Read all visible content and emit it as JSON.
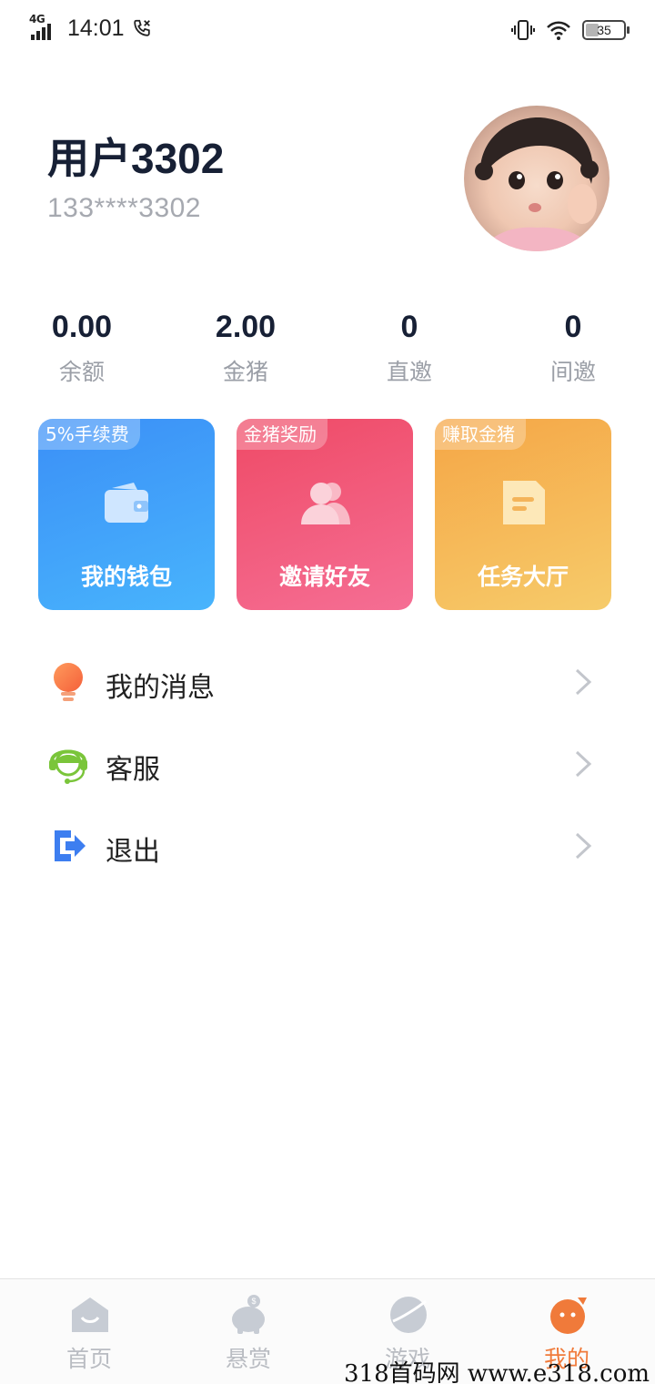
{
  "status_bar": {
    "network": "4G",
    "time": "14:01",
    "battery": "35",
    "battery_level": 0.35,
    "icons": [
      "signal-icon",
      "call-icon",
      "vibrate-icon",
      "wifi-icon",
      "battery-icon"
    ]
  },
  "profile": {
    "name": "用户3302",
    "phone": "133****3302"
  },
  "stats": [
    {
      "value": "0.00",
      "label": "余额"
    },
    {
      "value": "2.00",
      "label": "金猪"
    },
    {
      "value": "0",
      "label": "直邀"
    },
    {
      "value": "0",
      "label": "间邀"
    }
  ],
  "cards": {
    "wallet": {
      "tag": "5%手续费",
      "label": "我的钱包",
      "icon": "wallet-icon",
      "color": "#3b8ff7"
    },
    "invite": {
      "tag": "金猪奖励",
      "label": "邀请好友",
      "icon": "users-icon",
      "color": "#ef4a66"
    },
    "task": {
      "tag": "赚取金猪",
      "label": "任务大厅",
      "icon": "document-icon",
      "color": "#f5a646"
    }
  },
  "menu": [
    {
      "label": "我的消息",
      "icon": "bulb-icon"
    },
    {
      "label": "客服",
      "icon": "headset-icon"
    },
    {
      "label": "退出",
      "icon": "exit-icon"
    }
  ],
  "nav": [
    {
      "label": "首页",
      "icon": "home-icon",
      "active": false
    },
    {
      "label": "悬赏",
      "icon": "piggy-bank-icon",
      "active": false
    },
    {
      "label": "游戏",
      "icon": "planet-icon",
      "active": false
    },
    {
      "label": "我的",
      "icon": "profile-face-icon",
      "active": true
    }
  ],
  "colors": {
    "accent": "#f07a3a",
    "nav_inactive": "#b9bcc2"
  },
  "watermark": "318首码网 www.e318.com"
}
